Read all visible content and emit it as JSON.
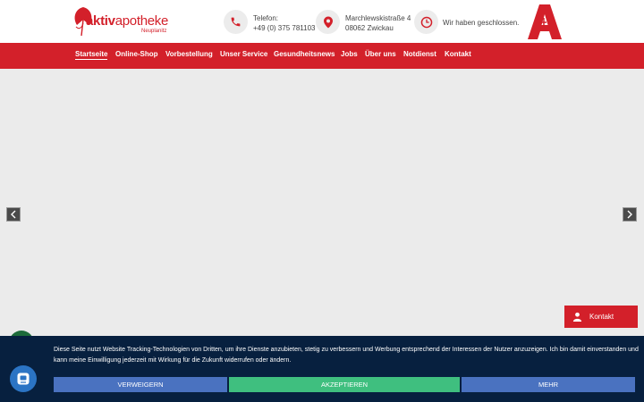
{
  "brand": {
    "logo_main": "aktiv",
    "logo_suffix": "apotheke",
    "logo_sub": "Neuplanitz"
  },
  "contact": {
    "phone_label": "Telefon:",
    "phone_number": "+49 (0) 375 781103",
    "street": "Marchlewskistraße 4",
    "city": "08062 Zwickau",
    "hours_status": "Wir haben geschlossen."
  },
  "nav": [
    "Startseite",
    "Online-Shop",
    "Vorbestellung",
    "Unser Service",
    "Gesundheitsnews",
    "Jobs",
    "Über uns",
    "Notdienst",
    "Kontakt"
  ],
  "kontakt_button": "Kontakt",
  "cookie": {
    "text": "Diese Seite nutzt Website Tracking-Technologien von Dritten, um ihre Dienste anzubieten, stetig zu verbessern und Werbung entsprechend der Interessen der Nutzer anzuzeigen. Ich bin damit einverstanden und kann meine Einwilligung jederzeit mit Wirkung für die Zukunft widerrufen oder ändern.",
    "reject": "VERWEIGERN",
    "accept": "AKZEPTIEREN",
    "more": "MEHR"
  },
  "colors": {
    "brand_red": "#d3202a",
    "banner_bg": "#07203f",
    "btn_blue": "#4a72c0",
    "btn_green": "#3fbf7f"
  },
  "icons": [
    "ginkgo-logo-icon",
    "phone-icon",
    "location-pin-icon",
    "clock-icon",
    "apotheke-a-icon",
    "arrow-left-icon",
    "arrow-right-icon",
    "person-icon",
    "chat-icon"
  ]
}
